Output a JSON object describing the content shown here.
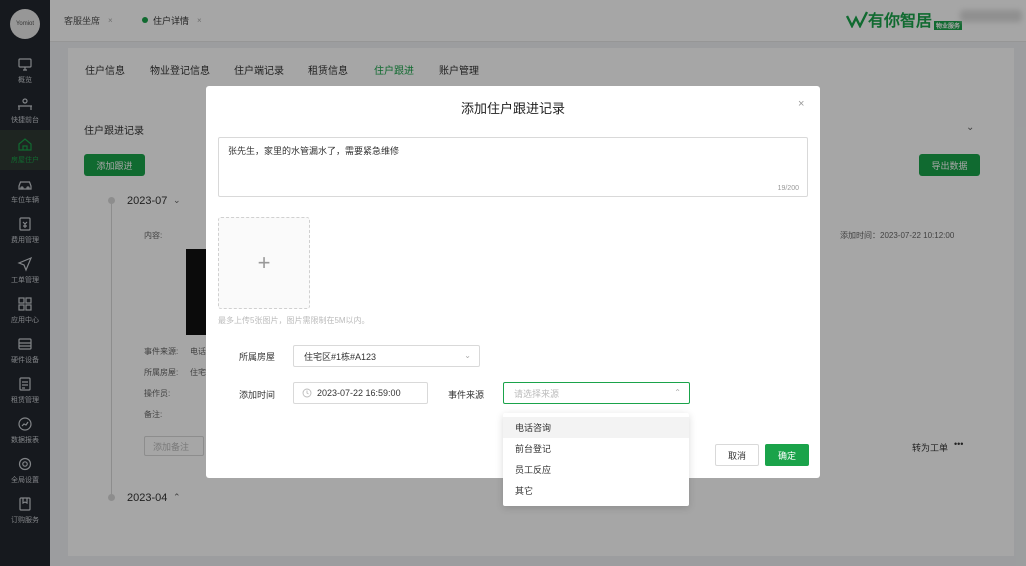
{
  "sidebar": {
    "logo": "Yomiot",
    "items": [
      {
        "label": "概览",
        "icon": "monitor-icon"
      },
      {
        "label": "快捷前台",
        "icon": "desk-icon"
      },
      {
        "label": "房屋住户",
        "icon": "house-icon"
      },
      {
        "label": "车位车辆",
        "icon": "car-icon"
      },
      {
        "label": "费用管理",
        "icon": "bill-icon"
      },
      {
        "label": "工单管理",
        "icon": "send-icon"
      },
      {
        "label": "应用中心",
        "icon": "apps-icon"
      },
      {
        "label": "硬件设备",
        "icon": "device-icon"
      },
      {
        "label": "租赁管理",
        "icon": "lease-icon"
      },
      {
        "label": "数据报表",
        "icon": "chart-icon"
      },
      {
        "label": "全局设置",
        "icon": "settings-icon"
      },
      {
        "label": "订购服务",
        "icon": "order-icon"
      }
    ]
  },
  "topbar": {
    "tabs": [
      {
        "label": "客服坐席"
      },
      {
        "label": "住户详情"
      }
    ],
    "brand": "有你智居",
    "brand_tag": "物业服务"
  },
  "content": {
    "subtabs": [
      "住户信息",
      "物业登记信息",
      "住户端记录",
      "租赁信息",
      "住户跟进",
      "账户管理"
    ],
    "section_title": "住户跟进记录",
    "add_button": "添加跟进",
    "export_button": "导出数据",
    "year1": "2023-07",
    "year2": "2023-04",
    "content_label": "内容:",
    "added_time": "添加时间：2023-07-22 10:12:00",
    "event_source_label": "事件来源:",
    "event_source_value": "电话",
    "room_label": "所属房屋:",
    "room_value": "住宅",
    "operator_label": "操作员:",
    "remark_label": "备注:",
    "remark_placeholder": "添加备注",
    "convert_link": "转为工单",
    "more": "•••"
  },
  "modal": {
    "title": "添加住户跟进记录",
    "close": "×",
    "text_value": "张先生，家里的水管漏水了，需要紧急维修",
    "counter": "19/200",
    "upload_plus": "+",
    "upload_hint": "最多上传5张图片，图片需限制在5M以内。",
    "room_label": "所属房屋",
    "room_value": "住宅区#1栋#A123",
    "time_label": "添加时间",
    "time_value": "2023-07-22 16:59:00",
    "source_label": "事件来源",
    "source_placeholder": "请选择来源",
    "cancel": "取消",
    "confirm": "确定"
  },
  "dropdown": {
    "options": [
      "电话咨询",
      "前台登记",
      "员工反应",
      "其它"
    ]
  }
}
